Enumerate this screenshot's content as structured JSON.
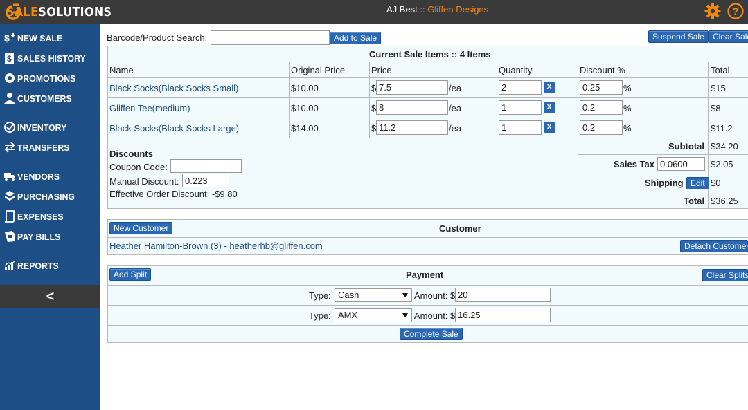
{
  "app": {
    "logo_sale": "SALE",
    "logo_solutions": "SOLUTIONS",
    "user_name": "AJ Best",
    "separator": " :: ",
    "company": "Gliffen Designs",
    "colors": {
      "topbar": "#3a3a3a",
      "sidebar": "#1d4f86",
      "accent": "#f08a16",
      "button": "#2b68b4",
      "panel": "#f1fbfd"
    }
  },
  "sidebar": {
    "items": [
      {
        "label": "NEW SALE",
        "icon": "new-sale-icon"
      },
      {
        "label": "SALES HISTORY",
        "icon": "dollar-doc-icon"
      },
      {
        "label": "PROMOTIONS",
        "icon": "badge-icon"
      },
      {
        "label": "CUSTOMERS",
        "icon": "user-icon"
      },
      {
        "label": "INVENTORY",
        "icon": "check-circle-icon"
      },
      {
        "label": "TRANSFERS",
        "icon": "arrows-icon"
      },
      {
        "label": "VENDORS",
        "icon": "truck-icon"
      },
      {
        "label": "PURCHASING",
        "icon": "boxes-icon"
      },
      {
        "label": "EXPENSES",
        "icon": "receipt-icon"
      },
      {
        "label": "PAY BILLS",
        "icon": "bill-icon"
      },
      {
        "label": "REPORTS",
        "icon": "bar-chart-icon"
      }
    ],
    "collapse_label": "<"
  },
  "search": {
    "label": "Barcode/Product Search:",
    "value": "",
    "add_button": "Add to Sale"
  },
  "top_actions": {
    "suspend": "Suspend Sale",
    "clear": "Clear Sale"
  },
  "sale_items": {
    "title": "Current Sale Items :: 4 Items",
    "columns": [
      "Name",
      "Original Price",
      "Price",
      "Quantity",
      "Discount %",
      "Total"
    ],
    "rows": [
      {
        "name": "Black Socks(Black Socks Small)",
        "original_price": "$10.00",
        "currency": "$",
        "price": "7.5",
        "per": "/ea",
        "quantity": "2",
        "remove": "X",
        "discount": "0.25",
        "pct": "%",
        "total": "$15"
      },
      {
        "name": "Gliffen Tee(medium)",
        "original_price": "$10.00",
        "currency": "$",
        "price": "8",
        "per": "/ea",
        "quantity": "1",
        "remove": "X",
        "discount": "0.2",
        "pct": "%",
        "total": "$8"
      },
      {
        "name": "Black Socks(Black Socks Large)",
        "original_price": "$14.00",
        "currency": "$",
        "price": "11.2",
        "per": "/ea",
        "quantity": "1",
        "remove": "X",
        "discount": "0.2",
        "pct": "%",
        "total": "$11.2"
      }
    ]
  },
  "discounts": {
    "title": "Discounts",
    "coupon_label": "Coupon Code:",
    "coupon_value": "",
    "manual_label": "Manual Discount:",
    "manual_value": "0.223",
    "effective_label": "Effective Order Discount: -$9.80"
  },
  "totals": {
    "subtotal_label": "Subtotal",
    "subtotal_value": "$34.20",
    "tax_label": "Sales Tax",
    "tax_rate": "0.0600",
    "tax_value": "$2.05",
    "shipping_label": "Shipping",
    "shipping_edit": "Edit",
    "shipping_value": "$0",
    "total_label": "Total",
    "total_value": "$36.25"
  },
  "customer": {
    "new_button": "New Customer",
    "title": "Customer",
    "name": "Heather Hamilton-Brown (3) - heatherhb@gliffen.com",
    "detach_button": "Detach Customer"
  },
  "payment": {
    "add_split": "Add Split",
    "title": "Payment",
    "clear_splits": "Clear Splits",
    "type_label": "Type:",
    "amount_label": "Amount:",
    "currency": "$",
    "splits": [
      {
        "type": "Cash",
        "amount": "20"
      },
      {
        "type": "AMX",
        "amount": "16.25"
      }
    ],
    "complete_button": "Complete Sale"
  }
}
